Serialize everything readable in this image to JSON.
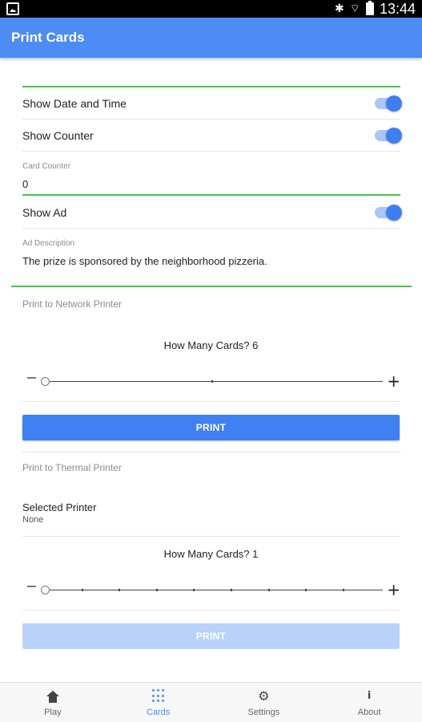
{
  "status_bar": {
    "time": "13:44"
  },
  "app_bar": {
    "title": "Print Cards"
  },
  "options": {
    "show_date_time": {
      "label": "Show Date and Time",
      "on": true
    },
    "show_counter": {
      "label": "Show Counter",
      "on": true
    },
    "card_counter": {
      "label": "Card Counter",
      "value": "0"
    },
    "show_ad": {
      "label": "Show Ad",
      "on": true
    },
    "ad_description": {
      "label": "Ad Description",
      "value": "The prize is sponsored by the neighborhood pizzeria."
    }
  },
  "network_printer": {
    "section_title": "Print to Network Printer",
    "how_many": "How Many Cards? 6",
    "slider_value": 6,
    "print_label": "PRINT"
  },
  "thermal_printer": {
    "section_title": "Print to Thermal Printer",
    "selected_printer_label": "Selected Printer",
    "selected_printer_value": "None",
    "how_many": "How Many Cards? 1",
    "slider_value": 1,
    "print_label": "PRINT",
    "print_enabled": false
  },
  "bottom_nav": {
    "items": [
      {
        "label": "Play",
        "icon": "home-icon"
      },
      {
        "label": "Cards",
        "icon": "grid-dots-icon",
        "active": true
      },
      {
        "label": "Settings",
        "icon": "gear-icon"
      },
      {
        "label": "About",
        "icon": "info-icon"
      }
    ]
  },
  "colors": {
    "primary": "#4d8bf5",
    "button": "#3f80f3",
    "button_disabled": "#b8d2fb",
    "accent_line": "#43c74b"
  }
}
